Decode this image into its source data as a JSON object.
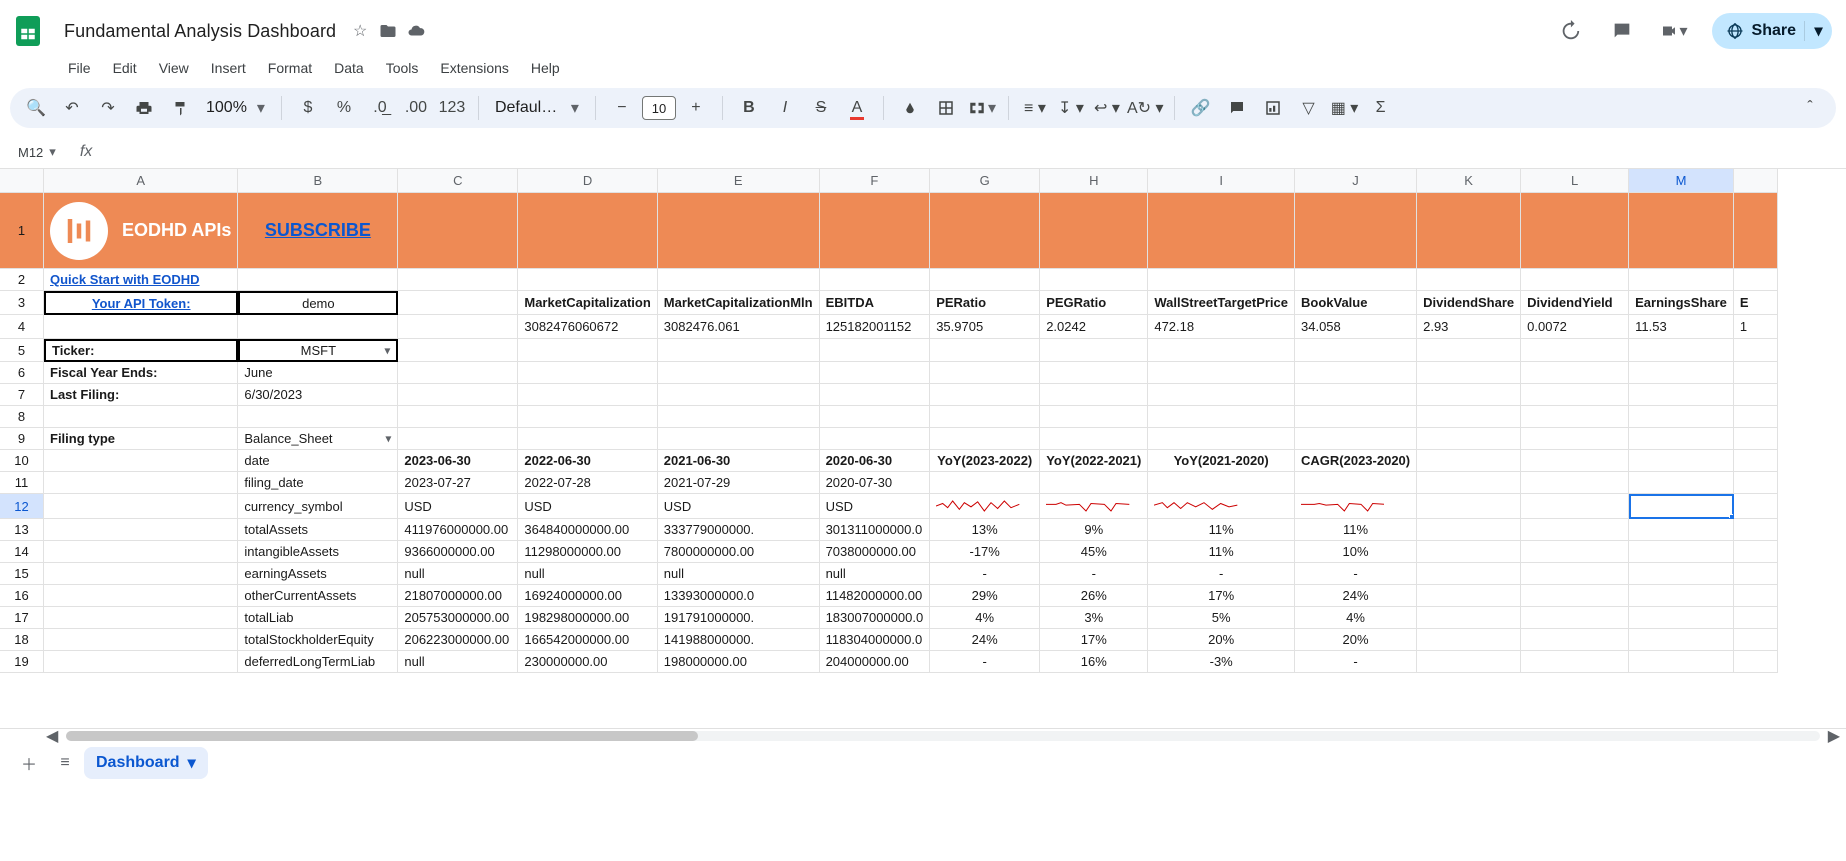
{
  "doc": {
    "title": "Fundamental Analysis Dashboard"
  },
  "menubar": {
    "file": "File",
    "edit": "Edit",
    "view": "View",
    "insert": "Insert",
    "format": "Format",
    "data": "Data",
    "tools": "Tools",
    "extensions": "Extensions",
    "help": "Help"
  },
  "toolbar": {
    "zoom": "100%",
    "font": "Defaul…",
    "size": "10",
    "fmt123": "123"
  },
  "share": {
    "label": "Share"
  },
  "namebox": {
    "ref": "M12"
  },
  "cols": {
    "A": "A",
    "B": "B",
    "C": "C",
    "D": "D",
    "E": "E",
    "F": "F",
    "G": "G",
    "H": "H",
    "I": "I",
    "J": "J",
    "K": "K",
    "L": "L",
    "M": "M",
    "N": ""
  },
  "row1": {
    "brand": "EODHD APIs",
    "subscribe": "SUBSCRIBE"
  },
  "row2": {
    "A": "Quick Start with EODHD"
  },
  "row3": {
    "A": "Your API Token:",
    "B": "demo",
    "D": "MarketCapitalization",
    "E": "MarketCapitalizationMln",
    "F": "EBITDA",
    "G": "PERatio",
    "H": "PEGRatio",
    "I": "WallStreetTargetPrice",
    "J": "BookValue",
    "K": "DividendShare",
    "L": "DividendYield",
    "M": "EarningsShare",
    "N": "E"
  },
  "row4": {
    "D": "3082476060672",
    "E": "3082476.061",
    "F": "125182001152",
    "G": "35.9705",
    "H": "2.0242",
    "I": "472.18",
    "J": "34.058",
    "K": "2.93",
    "L": "0.0072",
    "M": "11.53",
    "N": "1"
  },
  "row5": {
    "A": "Ticker:",
    "B": "MSFT"
  },
  "row6": {
    "A": "Fiscal Year Ends:",
    "B": "June"
  },
  "row7": {
    "A": "Last Filing:",
    "B": "6/30/2023"
  },
  "row9": {
    "A": "Filing type",
    "B": "Balance_Sheet"
  },
  "row10": {
    "B": "date",
    "C": "2023-06-30",
    "D": "2022-06-30",
    "E": "2021-06-30",
    "F": "2020-06-30",
    "G": "YoY(2023-2022)",
    "H": "YoY(2022-2021)",
    "I": "YoY(2021-2020)",
    "J": "CAGR(2023-2020)"
  },
  "row11": {
    "B": "filing_date",
    "C": "2023-07-27",
    "D": "2022-07-28",
    "E": "2021-07-29",
    "F": "2020-07-30"
  },
  "row12": {
    "B": "currency_symbol",
    "C": "USD",
    "D": "USD",
    "E": "USD",
    "F": "USD"
  },
  "row13": {
    "B": "totalAssets",
    "C": "411976000000.00",
    "D": "364840000000.00",
    "E": "333779000000.",
    "F": "301311000000.0",
    "G": "13%",
    "H": "9%",
    "I": "11%",
    "J": "11%"
  },
  "row14": {
    "B": "intangibleAssets",
    "C": "9366000000.00",
    "D": "11298000000.00",
    "E": "7800000000.00",
    "F": "7038000000.00",
    "G": "-17%",
    "H": "45%",
    "I": "11%",
    "J": "10%"
  },
  "row15": {
    "B": "earningAssets",
    "C": "null",
    "D": "null",
    "E": "null",
    "F": "null",
    "G": "-",
    "H": "-",
    "I": "-",
    "J": "-"
  },
  "row16": {
    "B": "otherCurrentAssets",
    "C": "21807000000.00",
    "D": "16924000000.00",
    "E": "13393000000.0",
    "F": "11482000000.00",
    "G": "29%",
    "H": "26%",
    "I": "17%",
    "J": "24%"
  },
  "row17": {
    "B": "totalLiab",
    "C": "205753000000.00",
    "D": "198298000000.00",
    "E": "191791000000.",
    "F": "183007000000.0",
    "G": "4%",
    "H": "3%",
    "I": "5%",
    "J": "4%"
  },
  "row18": {
    "B": "totalStockholderEquity",
    "C": "206223000000.00",
    "D": "166542000000.00",
    "E": "141988000000.",
    "F": "118304000000.0",
    "G": "24%",
    "H": "17%",
    "I": "20%",
    "J": "20%"
  },
  "row19": {
    "B": "deferredLongTermLiab",
    "C": "null",
    "D": "230000000.00",
    "E": "198000000.00",
    "F": "204000000.00",
    "G": "-",
    "H": "16%",
    "I": "-3%",
    "J": "-"
  },
  "sheet_tab": {
    "name": "Dashboard"
  }
}
